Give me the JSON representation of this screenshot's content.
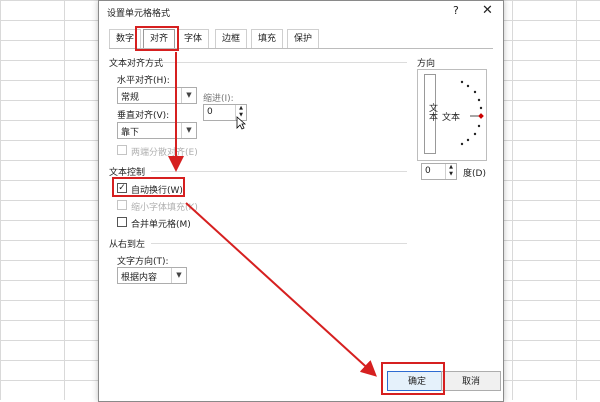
{
  "dialog": {
    "title": "设置单元格格式",
    "help_glyph": "?",
    "close_glyph": "✕"
  },
  "tabs": [
    "数字",
    "对齐",
    "字体",
    "边框",
    "填充",
    "保护"
  ],
  "active_tab": "对齐",
  "text_alignment": {
    "section_label": "文本对齐方式",
    "horizontal_label": "水平对齐(H):",
    "horizontal_value": "常规",
    "indent_label": "缩进(I):",
    "indent_value": "0",
    "vertical_label": "垂直对齐(V):",
    "vertical_value": "靠下",
    "distributed_label": "两端分散对齐(E)"
  },
  "text_control": {
    "section_label": "文本控制",
    "wrap_text_label": "自动换行(W)",
    "wrap_text_checked": true,
    "shrink_label": "缩小字体填充(K)",
    "merge_label": "合并单元格(M)"
  },
  "rtl": {
    "section_label": "从右到左",
    "direction_label": "文字方向(T):",
    "direction_value": "根据内容"
  },
  "orientation": {
    "section_label": "方向",
    "vertical_text": "文本",
    "horizontal_text": "文本",
    "degrees_value": "0",
    "degrees_label": "度(D)"
  },
  "buttons": {
    "ok_label": "确定",
    "cancel_label": "取消"
  },
  "colors": {
    "highlight": "#d62020"
  }
}
